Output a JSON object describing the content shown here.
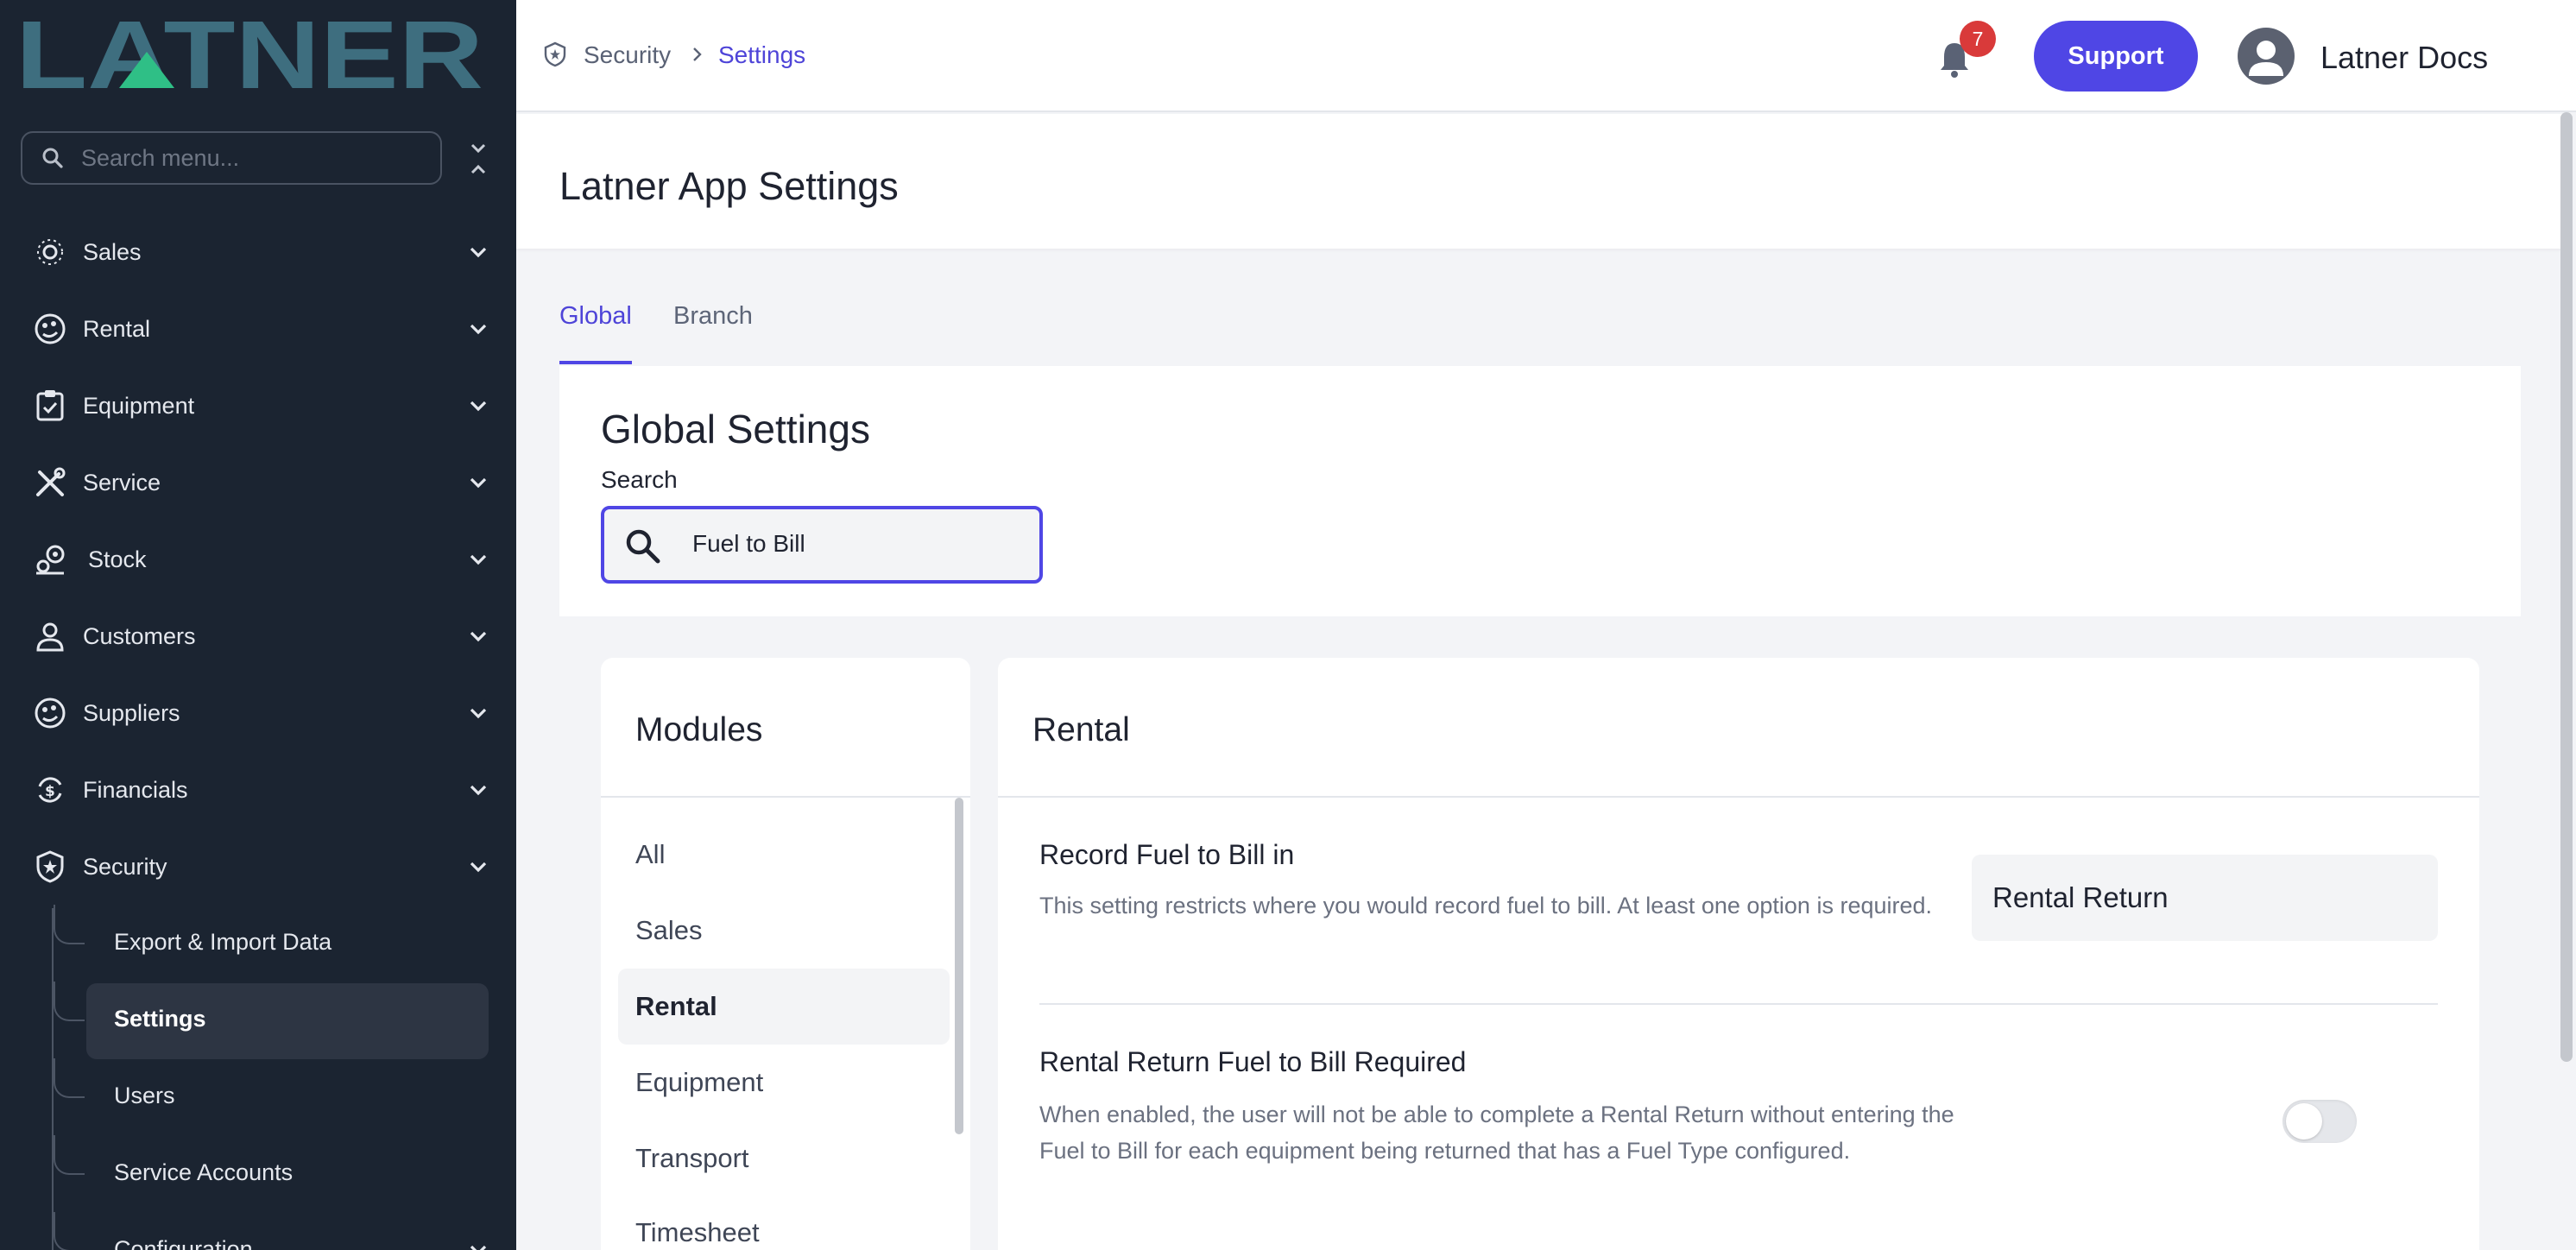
{
  "sidebar": {
    "logo_text": "LATNER",
    "search_placeholder": "Search menu...",
    "items": [
      {
        "label": "Sales",
        "icon": "sales-icon"
      },
      {
        "label": "Rental",
        "icon": "rental-icon"
      },
      {
        "label": "Equipment",
        "icon": "equipment-icon"
      },
      {
        "label": "Service",
        "icon": "service-icon"
      },
      {
        "label": "Stock",
        "icon": "stock-icon"
      },
      {
        "label": "Customers",
        "icon": "customers-icon"
      },
      {
        "label": "Suppliers",
        "icon": "suppliers-icon"
      },
      {
        "label": "Financials",
        "icon": "financials-icon"
      },
      {
        "label": "Security",
        "icon": "security-icon"
      }
    ],
    "security_sub": [
      {
        "label": "Export & Import Data"
      },
      {
        "label": "Settings",
        "active": true
      },
      {
        "label": "Users"
      },
      {
        "label": "Service Accounts"
      },
      {
        "label": "Configuration"
      }
    ]
  },
  "topbar": {
    "breadcrumb": [
      "Security",
      "Settings"
    ],
    "notification_count": "7",
    "support_label": "Support",
    "user_name": "Latner Docs"
  },
  "page": {
    "title": "Latner App Settings",
    "tabs": [
      {
        "label": "Global",
        "active": true
      },
      {
        "label": "Branch"
      }
    ]
  },
  "global_settings": {
    "title": "Global Settings",
    "search_label": "Search",
    "search_value": "Fuel to Bill"
  },
  "modules": {
    "title": "Modules",
    "items": [
      "All",
      "Sales",
      "Rental",
      "Equipment",
      "Transport",
      "Timesheet"
    ],
    "active": "Rental"
  },
  "rental": {
    "title": "Rental",
    "settings": [
      {
        "title": "Record Fuel to Bill in",
        "description": "This setting restricts where you would record fuel to bill. At least one option is required.",
        "value": "Rental Return"
      },
      {
        "title": "Rental Return Fuel to Bill Required",
        "description": "When enabled, the user will not be able to complete a Rental Return without entering the Fuel to Bill for each equipment being returned that has a Fuel Type configured.",
        "enabled": false
      }
    ]
  },
  "colors": {
    "sidebar_bg": "#1b2431",
    "accent": "#4f46e5",
    "badge": "#d93a3a",
    "logo": "#3e6e7f",
    "logo_triangle": "#2fbf86"
  }
}
